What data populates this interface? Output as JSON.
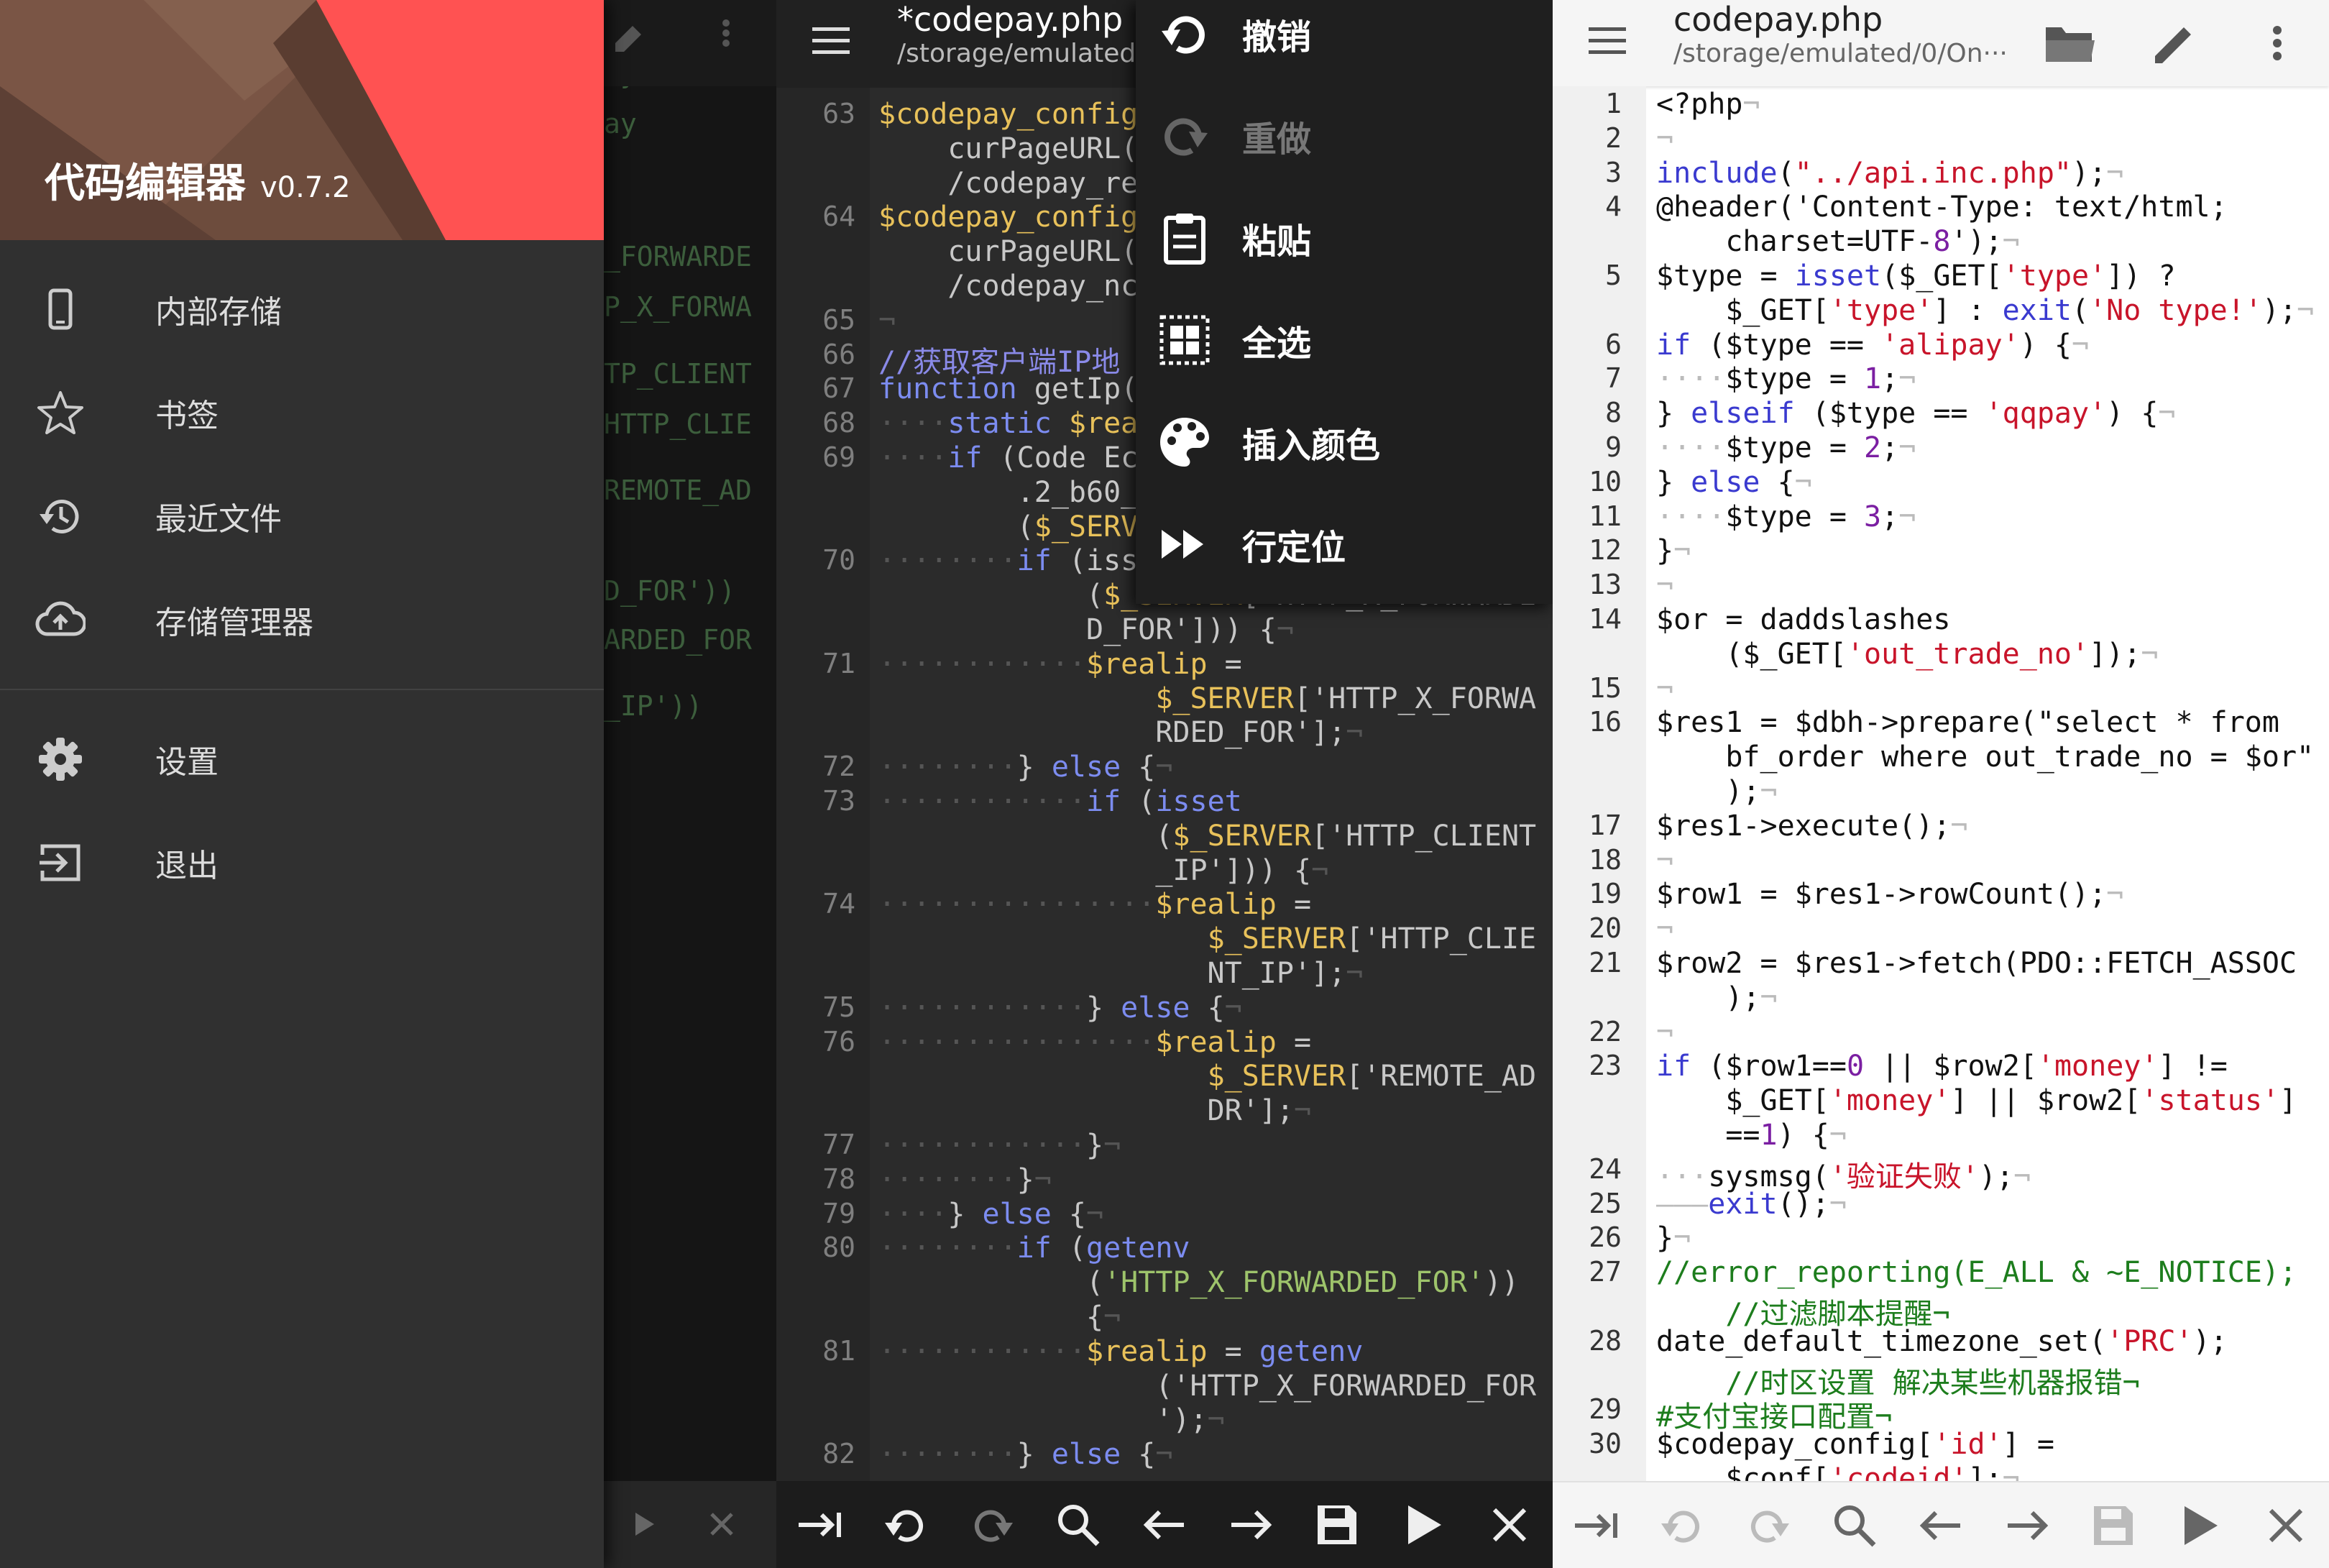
{
  "drawer": {
    "app_name": "代码编辑器",
    "version": "v0.7.2",
    "items": [
      {
        "label": "内部存储",
        "icon": "phone-icon"
      },
      {
        "label": "书签",
        "icon": "star-icon"
      },
      {
        "label": "最近文件",
        "icon": "history-icon"
      },
      {
        "label": "存储管理器",
        "icon": "cloud-upload-icon"
      },
      {
        "label": "设置",
        "icon": "gear-icon"
      },
      {
        "label": "退出",
        "icon": "exit-icon"
      }
    ],
    "bg_code": [
      "ay",
      "ay",
      "_FORWARDE",
      "P_X_FORWA",
      "TP_CLIENT",
      "HTTP_CLIE",
      "REMOTE_AD",
      "D_FOR'))",
      "ARDED_FOR",
      "_IP'))"
    ]
  },
  "editor_dark": {
    "file_name": "*codepay.php",
    "file_path": "/storage/emulated",
    "menu": [
      {
        "label": "撤销",
        "icon": "undo-icon",
        "enabled": true
      },
      {
        "label": "重做",
        "icon": "redo-icon",
        "enabled": false
      },
      {
        "label": "粘贴",
        "icon": "paste-icon",
        "enabled": true
      },
      {
        "label": "全选",
        "icon": "select-all-icon",
        "enabled": true
      },
      {
        "label": "插入颜色",
        "icon": "palette-icon",
        "enabled": true
      },
      {
        "label": "行定位",
        "icon": "goto-line-icon",
        "enabled": true
      }
    ],
    "lines": [
      {
        "n": "63",
        "t": "$codepay_config"
      },
      {
        "n": "",
        "t": "    curPageURL("
      },
      {
        "n": "",
        "t": "    /codepay_re"
      },
      {
        "n": "64",
        "t": "$codepay_config"
      },
      {
        "n": "",
        "t": "    curPageURL("
      },
      {
        "n": "",
        "t": "    /codepay_nc"
      },
      {
        "n": "65",
        "t": "¬"
      },
      {
        "n": "66",
        "t": "//获取客户端IP地"
      },
      {
        "n": "67",
        "t": "function getIp("
      },
      {
        "n": "68",
        "t": "····static $rea"
      },
      {
        "n": "69",
        "t": "····if (Code Ec"
      },
      {
        "n": "",
        "t": "        .2_b60_"
      },
      {
        "n": "",
        "t": "        ($_SERV"
      },
      {
        "n": "70",
        "t": "········if (iss"
      },
      {
        "n": "",
        "t": "            ($_SERVER['HTTP_X_FORWARDE"
      },
      {
        "n": "",
        "t": "            D_FOR'])) {¬"
      },
      {
        "n": "71",
        "t": "············$realip ="
      },
      {
        "n": "",
        "t": "                $_SERVER['HTTP_X_FORWA"
      },
      {
        "n": "",
        "t": "                RDED_FOR'];¬"
      },
      {
        "n": "72",
        "t": "········} else {¬"
      },
      {
        "n": "73",
        "t": "············if (isset"
      },
      {
        "n": "",
        "t": "                ($_SERVER['HTTP_CLIENT"
      },
      {
        "n": "",
        "t": "                _IP'])) {¬"
      },
      {
        "n": "74",
        "t": "················$realip ="
      },
      {
        "n": "",
        "t": "                   $_SERVER['HTTP_CLIE"
      },
      {
        "n": "",
        "t": "                   NT_IP'];¬"
      },
      {
        "n": "75",
        "t": "············} else {¬"
      },
      {
        "n": "76",
        "t": "················$realip ="
      },
      {
        "n": "",
        "t": "                   $_SERVER['REMOTE_AD"
      },
      {
        "n": "",
        "t": "                   DR'];¬"
      },
      {
        "n": "77",
        "t": "············}¬"
      },
      {
        "n": "78",
        "t": "········}¬"
      },
      {
        "n": "79",
        "t": "····} else {¬"
      },
      {
        "n": "80",
        "t": "········if (getenv"
      },
      {
        "n": "",
        "t": "            ('HTTP_X_FORWARDED_FOR'))"
      },
      {
        "n": "",
        "t": "            {¬"
      },
      {
        "n": "81",
        "t": "············$realip = getenv"
      },
      {
        "n": "",
        "t": "                ('HTTP_X_FORWARDED_FOR"
      },
      {
        "n": "",
        "t": "                ');¬"
      },
      {
        "n": "82",
        "t": "········} else {¬"
      }
    ]
  },
  "editor_light": {
    "file_name": "codepay.php",
    "file_path": "/storage/emulated/0/On···",
    "lines": [
      {
        "n": "1",
        "t": "<?php¬"
      },
      {
        "n": "2",
        "t": "¬"
      },
      {
        "n": "3",
        "t": "include(\"../api.inc.php\");¬"
      },
      {
        "n": "4",
        "t": "@header('Content-Type: text/html; "
      },
      {
        "n": "",
        "t": "    charset=UTF-8');¬"
      },
      {
        "n": "5",
        "t": "$type = isset($_GET['type']) ?"
      },
      {
        "n": "",
        "t": "    $_GET['type'] : exit('No type!');¬"
      },
      {
        "n": "6",
        "t": "if ($type == 'alipay') {¬"
      },
      {
        "n": "7",
        "t": "····$type = 1;¬"
      },
      {
        "n": "8",
        "t": "} elseif ($type == 'qqpay') {¬"
      },
      {
        "n": "9",
        "t": "····$type = 2;¬"
      },
      {
        "n": "10",
        "t": "} else {¬"
      },
      {
        "n": "11",
        "t": "····$type = 3;¬"
      },
      {
        "n": "12",
        "t": "}¬"
      },
      {
        "n": "13",
        "t": "¬"
      },
      {
        "n": "14",
        "t": "$or = daddslashes"
      },
      {
        "n": "",
        "t": "    ($_GET['out_trade_no']);¬"
      },
      {
        "n": "15",
        "t": "¬"
      },
      {
        "n": "16",
        "t": "$res1 = $dbh->prepare(\"select * from"
      },
      {
        "n": "",
        "t": "    bf_order where out_trade_no = $or\""
      },
      {
        "n": "",
        "t": "    );¬"
      },
      {
        "n": "17",
        "t": "$res1->execute();¬"
      },
      {
        "n": "18",
        "t": "¬"
      },
      {
        "n": "19",
        "t": "$row1 = $res1->rowCount();¬"
      },
      {
        "n": "20",
        "t": "¬"
      },
      {
        "n": "21",
        "t": "$row2 = $res1->fetch(PDO::FETCH_ASSOC"
      },
      {
        "n": "",
        "t": "    );¬"
      },
      {
        "n": "22",
        "t": "¬"
      },
      {
        "n": "23",
        "t": "if ($row1==0 || $row2['money'] != "
      },
      {
        "n": "",
        "t": "    $_GET['money'] || $row2['status']"
      },
      {
        "n": "",
        "t": "    ==1) {¬"
      },
      {
        "n": "24",
        "t": "···sysmsg('验证失败');¬"
      },
      {
        "n": "25",
        "t": "———exit();¬"
      },
      {
        "n": "26",
        "t": "}¬"
      },
      {
        "n": "27",
        "t": "//error_reporting(E_ALL & ~E_NOTICE); "
      },
      {
        "n": "",
        "t": "    //过滤脚本提醒¬"
      },
      {
        "n": "28",
        "t": "date_default_timezone_set('PRC'); "
      },
      {
        "n": "",
        "t": "    //时区设置 解决某些机器报错¬"
      },
      {
        "n": "29",
        "t": "#支付宝接口配置¬"
      },
      {
        "n": "30",
        "t": "$codepay_config['id'] ="
      },
      {
        "n": "",
        "t": "    $conf['codeid'];¬"
      }
    ]
  },
  "bottom_toolbar": [
    "tab-icon",
    "undo-icon",
    "redo-icon",
    "search-icon",
    "arrow-left-icon",
    "arrow-right-icon",
    "save-icon",
    "run-icon",
    "close-icon"
  ]
}
